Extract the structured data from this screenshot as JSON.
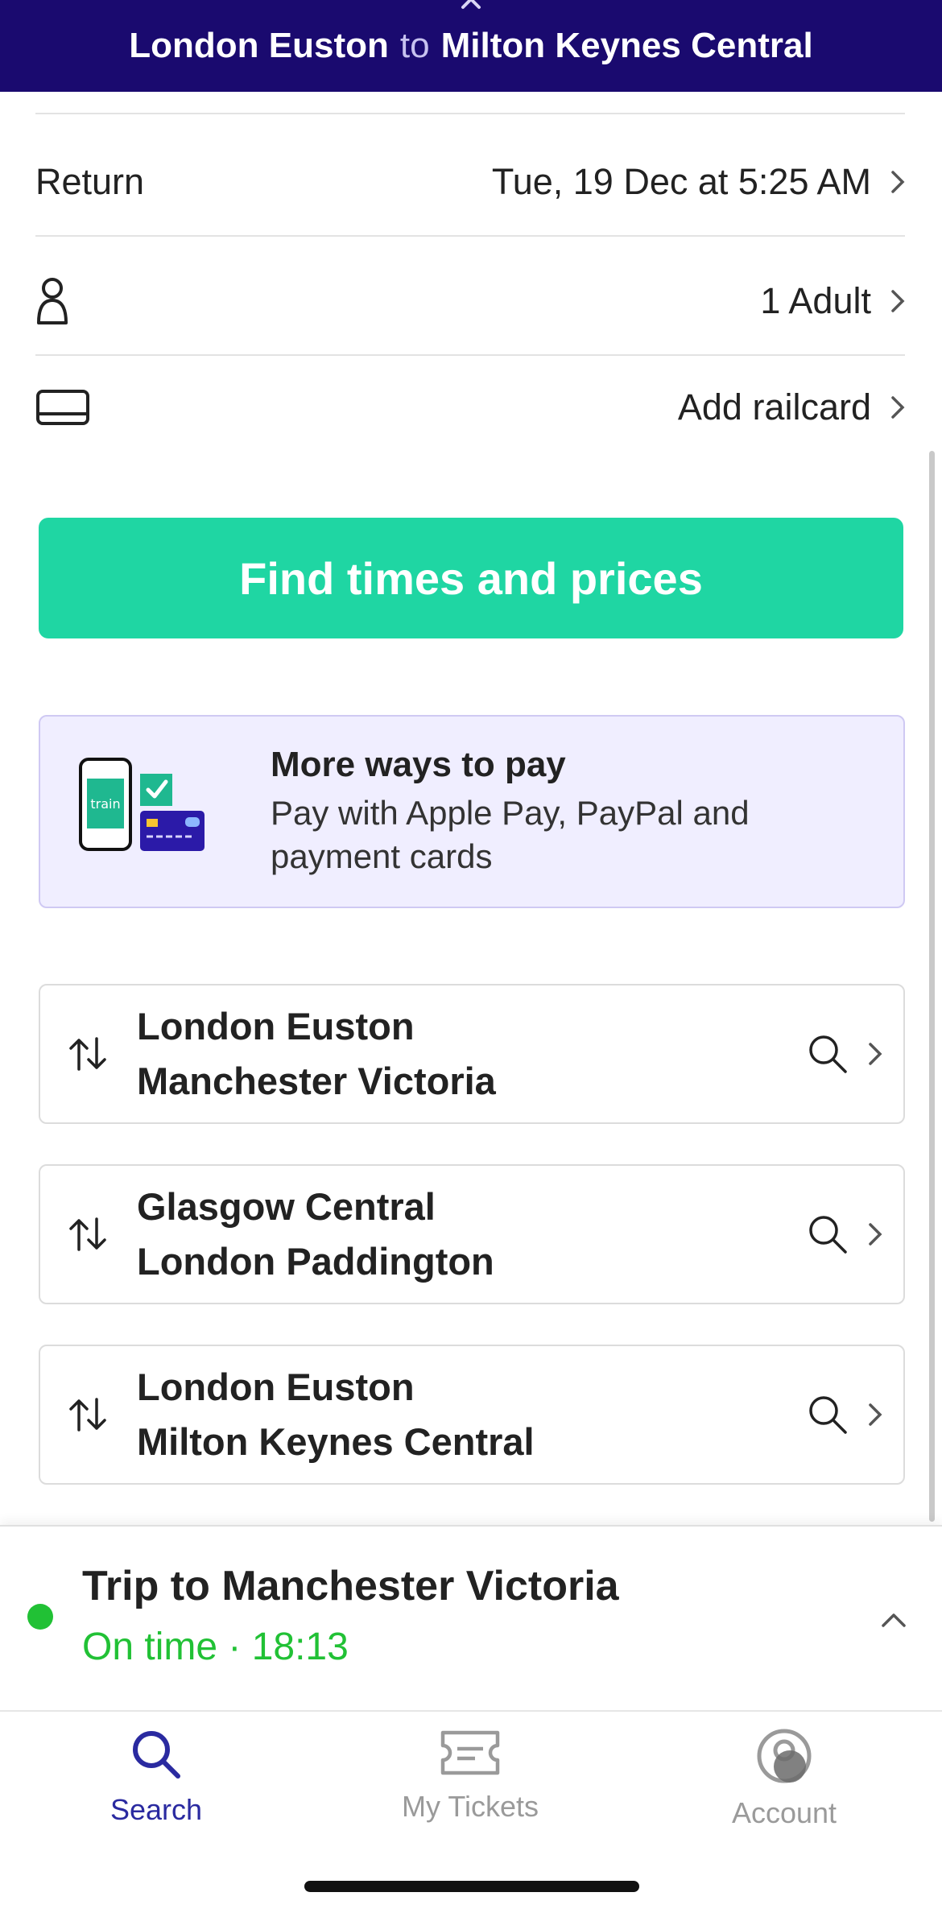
{
  "header": {
    "from": "London Euston",
    "connector": "to",
    "to": "Milton Keynes Central"
  },
  "journey": {
    "return_label": "Return",
    "return_value": "Tue, 19 Dec at 5:25 AM",
    "passengers_value": "1 Adult",
    "railcard_value": "Add railcard"
  },
  "cta": {
    "label": "Find times and prices"
  },
  "promo": {
    "title": "More ways to pay",
    "subtitle": "Pay with Apple Pay, PayPal and payment cards",
    "art_text": "train"
  },
  "recent_searches": [
    {
      "from": "London Euston",
      "to": "Manchester Victoria"
    },
    {
      "from": "Glasgow Central",
      "to": "London Paddington"
    },
    {
      "from": "London Euston",
      "to": "Milton Keynes Central"
    }
  ],
  "trip": {
    "title": "Trip to Manchester Victoria",
    "status": "On time · 18:13"
  },
  "tabs": [
    {
      "label": "Search",
      "active": true
    },
    {
      "label": "My Tickets",
      "active": false
    },
    {
      "label": "Account",
      "active": false
    }
  ],
  "colors": {
    "header_bg": "#1a0a6f",
    "cta": "#1fd6a3",
    "success": "#21c135",
    "active_tab": "#2a2aa0",
    "inactive_tab": "#9a9a9a"
  }
}
